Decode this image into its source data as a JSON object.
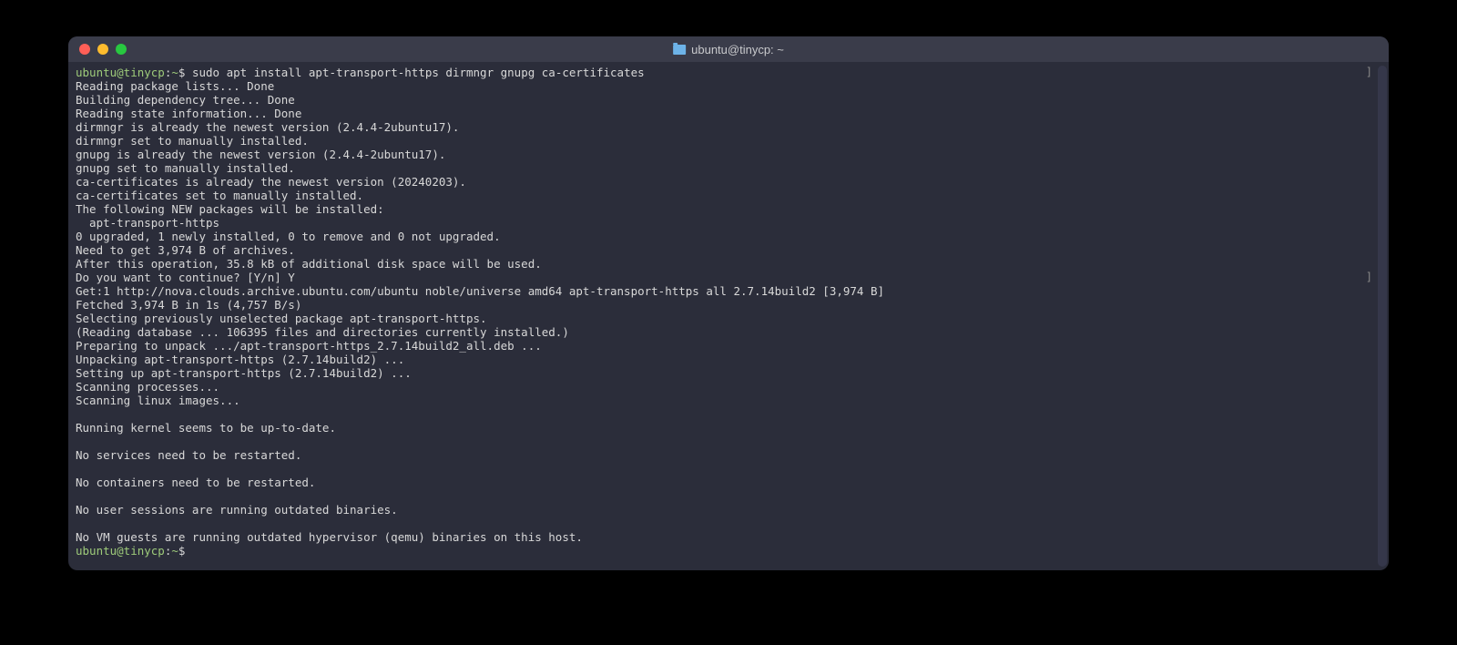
{
  "window": {
    "title": "ubuntu@tinycp: ~"
  },
  "prompt": {
    "userhost": "ubuntu@tinycp",
    "path": "~",
    "symbol": "$"
  },
  "command1": "sudo apt install apt-transport-https dirmngr gnupg ca-certificates",
  "output": [
    "Reading package lists... Done",
    "Building dependency tree... Done",
    "Reading state information... Done",
    "dirmngr is already the newest version (2.4.4-2ubuntu17).",
    "dirmngr set to manually installed.",
    "gnupg is already the newest version (2.4.4-2ubuntu17).",
    "gnupg set to manually installed.",
    "ca-certificates is already the newest version (20240203).",
    "ca-certificates set to manually installed.",
    "The following NEW packages will be installed:",
    "  apt-transport-https",
    "0 upgraded, 1 newly installed, 0 to remove and 0 not upgraded.",
    "Need to get 3,974 B of archives.",
    "After this operation, 35.8 kB of additional disk space will be used.",
    "Do you want to continue? [Y/n] Y",
    "Get:1 http://nova.clouds.archive.ubuntu.com/ubuntu noble/universe amd64 apt-transport-https all 2.7.14build2 [3,974 B]",
    "Fetched 3,974 B in 1s (4,757 B/s)",
    "Selecting previously unselected package apt-transport-https.",
    "(Reading database ... 106395 files and directories currently installed.)",
    "Preparing to unpack .../apt-transport-https_2.7.14build2_all.deb ...",
    "Unpacking apt-transport-https (2.7.14build2) ...",
    "Setting up apt-transport-https (2.7.14build2) ...",
    "Scanning processes...",
    "Scanning linux images...",
    "",
    "Running kernel seems to be up-to-date.",
    "",
    "No services need to be restarted.",
    "",
    "No containers need to be restarted.",
    "",
    "No user sessions are running outdated binaries.",
    "",
    "No VM guests are running outdated hypervisor (qemu) binaries on this host."
  ],
  "markers": {
    "bracket": "]"
  }
}
